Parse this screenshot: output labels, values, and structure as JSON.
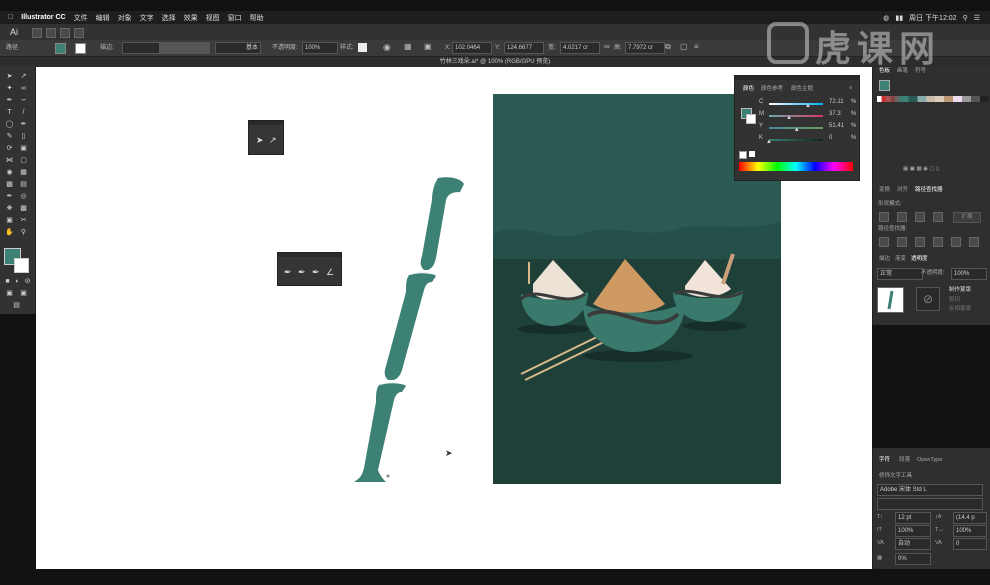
{
  "menubar": {
    "app": "Illustrator CC",
    "items": [
      "文件",
      "编辑",
      "对象",
      "文字",
      "选择",
      "效果",
      "视图",
      "窗口",
      "帮助"
    ],
    "clock": "周日 下午12:02"
  },
  "control_bar": {
    "path_label": "路径",
    "stroke_label": "描边:",
    "style_label": "基本",
    "opacity_label": "不透明度:",
    "opacity_value": "100%",
    "style2_label": "样式:",
    "x_label": "X:",
    "x_value": "102.0464",
    "y_label": "Y:",
    "y_value": "124.6677",
    "w_label": "宽:",
    "w_value": "4.0217 cr",
    "h_label": "高:",
    "h_value": "7.7972 cr"
  },
  "document": {
    "tab_title": "竹林三戏朵.ai* @ 100% (RGB/GPU 预览)"
  },
  "watermark": {
    "brand": "虎课网"
  },
  "color_panel": {
    "tabs": [
      "颜色",
      "颜色参考",
      "颜色主题"
    ],
    "channels": [
      {
        "name": "C",
        "value": "72.11",
        "unit": "%",
        "pct": 72.11
      },
      {
        "name": "M",
        "value": "37.3",
        "unit": "%",
        "pct": 37.3
      },
      {
        "name": "Y",
        "value": "51.41",
        "unit": "%",
        "pct": 51.41
      },
      {
        "name": "K",
        "value": "0",
        "unit": "%",
        "pct": 0
      }
    ]
  },
  "swatches_panel": {
    "tabs": [
      "色板",
      "画笔",
      "符号"
    ]
  },
  "align_panel": {
    "tabs": [
      "变换",
      "对齐",
      "路径查找器"
    ],
    "shape_modes_label": "形状模式:",
    "expand_label": "扩展",
    "pathfinder_label": "路径查找器:"
  },
  "transparency_panel": {
    "tabs": [
      "描边",
      "渐变",
      "透明度"
    ],
    "mode": "正常",
    "opacity_label": "不透明度:",
    "opacity_value": "100%",
    "make_mask": "制作蒙版",
    "clip": "剪切",
    "invert": "反相蒙版"
  },
  "character_panel": {
    "tabs": [
      "字符",
      "段落",
      "OpenType"
    ],
    "search_label": "修饰文字工具",
    "font": "Adobe 宋体 Std L",
    "size": "12 pt",
    "leading": "(14.4 p",
    "vscale": "100%",
    "hscale": "100%",
    "kern": "自动",
    "track": "0",
    "tsume": "0%"
  },
  "colors": {
    "artboard": "#2b5a52",
    "artboard_dark": "#1f3f39",
    "bamboo": "#3d8074",
    "accent_fill": "#3a7a6d"
  }
}
